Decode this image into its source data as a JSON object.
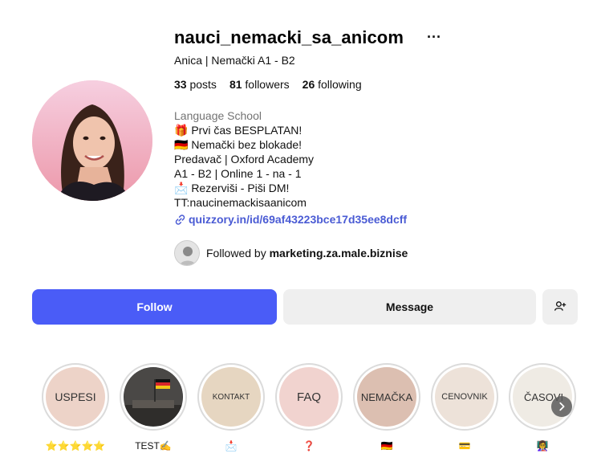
{
  "profile": {
    "username": "nauci_nemacki_sa_anicom",
    "more_label": "···",
    "full_name": "Anica | Nemački A1 - B2",
    "stats": {
      "posts_count": "33",
      "posts_label": "posts",
      "followers_count": "81",
      "followers_label": "followers",
      "following_count": "26",
      "following_label": "following"
    },
    "bio": {
      "category": "Language School",
      "lines": [
        "🎁 Prvi čas BESPLATAN!",
        "🇩🇪 Nemački bez blokade!",
        "Predavač | Oxford Academy",
        "A1 - B2 | Online 1 - na - 1",
        "📩 Rezerviši - Piši DM!",
        "TT:naucinemackisaanicom"
      ],
      "link": "quizzory.in/id/69af43223bce17d35ee8dcff"
    },
    "followed_by": {
      "prefix": "Followed by",
      "user": "marketing.za.male.biznise"
    }
  },
  "actions": {
    "follow_label": "Follow",
    "message_label": "Message",
    "add_icon": "add-person-icon"
  },
  "highlights": [
    {
      "cover_text": "USPESI",
      "label": "⭐⭐⭐⭐⭐",
      "bg": "#edd3c8"
    },
    {
      "cover_text": "",
      "label": "TEST✍️",
      "bg": "#4a4a4a"
    },
    {
      "cover_text": "KONTAKT",
      "label": "📩",
      "bg": "#e6d6c1"
    },
    {
      "cover_text": "FAQ",
      "label": "❓",
      "bg": "#f1d3cf"
    },
    {
      "cover_text": "NEMAČKA",
      "label": "🇩🇪",
      "bg": "#dcbfb1"
    },
    {
      "cover_text": "CENOVNIK",
      "label": "💳",
      "bg": "#ede2d9"
    },
    {
      "cover_text": "ČASOVI",
      "label": "👩‍🏫",
      "bg": "#efebe4"
    }
  ],
  "colors": {
    "accent": "#4a5cf7",
    "link": "#4a5bd4",
    "secondary_button": "#efefef"
  }
}
